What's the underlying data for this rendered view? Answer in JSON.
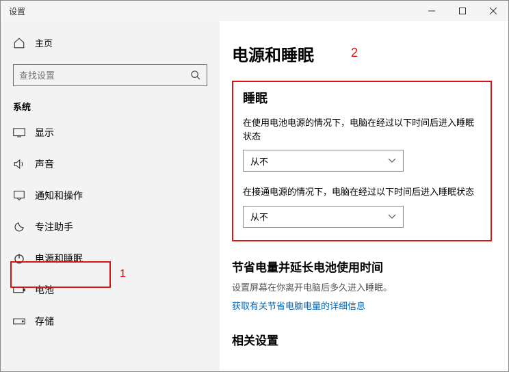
{
  "window": {
    "title": "设置"
  },
  "sidebar": {
    "home": "主页",
    "searchPlaceholder": "查找设置",
    "group": "系统",
    "items": [
      {
        "label": "显示"
      },
      {
        "label": "声音"
      },
      {
        "label": "通知和操作"
      },
      {
        "label": "专注助手"
      },
      {
        "label": "电源和睡眠"
      },
      {
        "label": "电池"
      },
      {
        "label": "存储"
      }
    ]
  },
  "annotations": {
    "one": "1",
    "two": "2"
  },
  "page": {
    "title": "电源和睡眠",
    "sleep": {
      "heading": "睡眠",
      "batteryLabel": "在使用电池电源的情况下，电脑在经过以下时间后进入睡眠状态",
      "batteryValue": "从不",
      "pluggedLabel": "在接通电源的情况下，电脑在经过以下时间后进入睡眠状态",
      "pluggedValue": "从不"
    },
    "save": {
      "heading": "节省电量并延长电池使用时间",
      "desc": "设置屏幕在你离开电脑后多久进入睡眠。",
      "link": "获取有关节省电脑电量的详细信息"
    },
    "related": {
      "heading": "相关设置"
    }
  }
}
